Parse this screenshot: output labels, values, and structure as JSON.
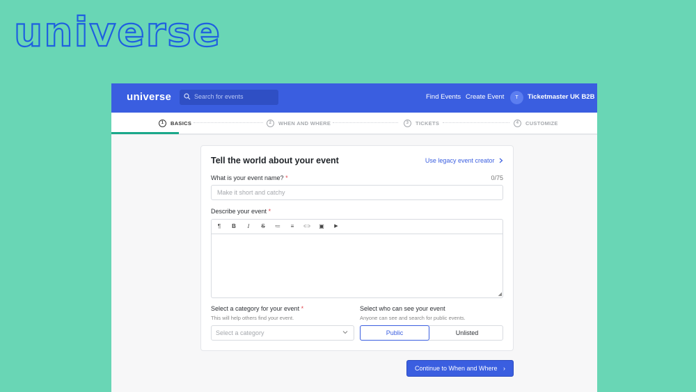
{
  "brand": {
    "big_logo": "universe",
    "app_logo": "universe"
  },
  "topbar": {
    "search_placeholder": "Search for events",
    "links": [
      "Find Events",
      "Create Event"
    ],
    "avatar_initial": "T",
    "user_name": "Ticketmaster UK B2B"
  },
  "steps": [
    {
      "num": "1",
      "label": "BASICS",
      "active": true
    },
    {
      "num": "2",
      "label": "WHEN AND WHERE",
      "active": false
    },
    {
      "num": "3",
      "label": "TICKETS",
      "active": false
    },
    {
      "num": "4",
      "label": "CUSTOMIZE",
      "active": false
    }
  ],
  "form": {
    "title": "Tell the world about your event",
    "legacy_link": "Use legacy event creator",
    "name_label": "What is your event name?",
    "required_mark": "*",
    "name_counter": "0/75",
    "name_placeholder": "Make it short and catchy",
    "describe_label": "Describe your event",
    "category_label": "Select a category for your event",
    "category_hint": "This will help others find your event.",
    "category_placeholder": "Select a category",
    "visibility_label": "Select who can see your event",
    "visibility_hint": "Anyone can see and search for public events.",
    "visibility_options": [
      "Public",
      "Unlisted"
    ],
    "visibility_selected": "Public"
  },
  "toolbar_icons": [
    "paragraph-icon",
    "bold-icon",
    "italic-icon",
    "strikethrough-icon",
    "bulleted-list-icon",
    "numbered-list-icon",
    "link-icon",
    "image-icon",
    "video-icon"
  ],
  "toolbar_glyphs": [
    "¶",
    "B",
    "I",
    "S",
    "≔",
    "≡",
    "⊂⊃",
    "▣",
    "▶"
  ],
  "cta": {
    "label": "Continue to When and Where",
    "chevron": "›"
  },
  "colors": {
    "background": "#69d6b5",
    "primary": "#3a5ee0",
    "active_step": "#1aa88a"
  }
}
